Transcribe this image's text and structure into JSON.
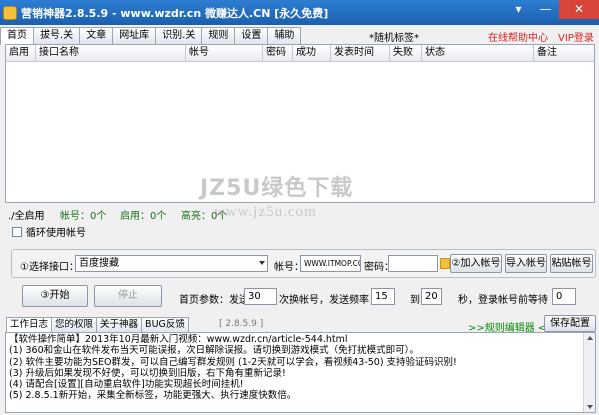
{
  "window": {
    "title": "营销神器2.8.5.9 - www.wzdr.cn 微赚达人.CN [永久免费]"
  },
  "tabs": [
    "首页",
    "拔号.关",
    "文章",
    "网址库",
    "识别.关",
    "规则",
    "设置",
    "辅助"
  ],
  "header": {
    "marquee": "*随机标签*",
    "help": "在线帮助中心",
    "vip": "VIP登录"
  },
  "grid": {
    "columns": [
      "启用",
      "接口名称",
      "帐号",
      "密码",
      "成功",
      "发表时间",
      "失败",
      "状态",
      "备注"
    ]
  },
  "watermark": {
    "line1": "JZ5U绿色下载",
    "line2": "www.jz5u.com"
  },
  "stats": {
    "all": "./全启用",
    "account": "帐号：0个",
    "enabled": "启用：0个",
    "high": "高亮：0个"
  },
  "loop": {
    "label": "循环使用帐号"
  },
  "iface": {
    "select_label": "①选择接口：",
    "select_value": "百度搜藏",
    "account_label": "帐号：",
    "account_value": "WWW.ITMOP.COM",
    "password_label": "密码：",
    "password_value": "",
    "add_btn": "②加入帐号",
    "import_btn": "导入帐号",
    "paste_btn": "粘贴帐号"
  },
  "controls": {
    "start_btn": "③开始",
    "stop_btn": "停止",
    "params_label": "首页参数：发送",
    "send_value": "30",
    "per_label": "次换帐号，发送频率",
    "freq_from": "15",
    "to_label": "到",
    "freq_to": "20",
    "wait_label": "秒，登录帐号前等待",
    "wait_value": "0"
  },
  "log": {
    "tabs": [
      "工作日志",
      "您的权限",
      "关于神器",
      "BUG反馈"
    ],
    "version": "[ 2.8.5.9 ]",
    "editor_link": ">>规则编辑器 <",
    "save_btn": "保存配置",
    "lines": [
      "【软件操作简单】2013年10月最新入门视频：www.wzdr.cn/article-544.html",
      "(1) 360和金山在软件发布当天可能误报，次日解除误报。请切换到游戏模式（免打扰模式即可）。",
      "(2) 软件主要功能为SEO群发，可以自己编写群发规则 (1-2天就可以学会，看视频43-50) 支持验证码识别!",
      "(3) 升级后如果发现不好使，可以切换到旧版，右下角有重新记录!",
      "(4) 请配合[设置][自动重启软件]功能实现超长时间挂机!",
      "(5) 2.8.5.1新开始，采集全新标签，功能更强大、执行速度快数倍。"
    ]
  }
}
